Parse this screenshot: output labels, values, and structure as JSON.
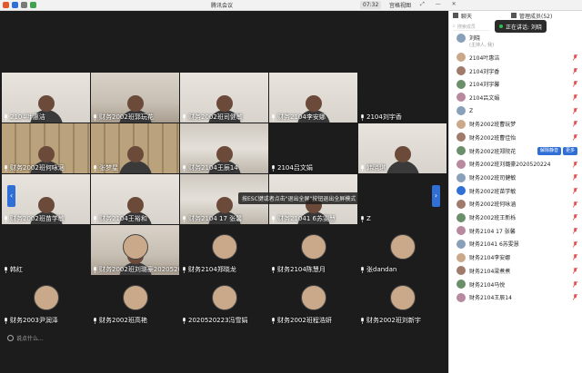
{
  "window": {
    "title": "腾讯会议",
    "time": "07:32",
    "layout_label": "宫格视图",
    "chat_tab": "聊天",
    "manage_tab": "管理成员(52)"
  },
  "toast": "按ESC键或者点击\"退出全屏\"按钮退出全屏模式",
  "chat_input": "说点什么...",
  "speaking": "正在讲话: 刘晓",
  "search_placeholder": "搜索成员",
  "tiles": [
    {
      "name": "2104叶惠洁",
      "style": "wall"
    },
    {
      "name": "财务2002班郭玩花",
      "style": "room"
    },
    {
      "name": "财务2002班司健敏",
      "style": "wall"
    },
    {
      "name": "财务2104李安娜",
      "style": "wall"
    },
    {
      "name": "2104刘宇香",
      "style": "dark"
    },
    {
      "name": "财务2002班何咏涵",
      "style": "shelf"
    },
    {
      "name": "张梦星",
      "style": "shelf"
    },
    {
      "name": "财务2104王辰14",
      "style": "office"
    },
    {
      "name": "2104吕文娟",
      "style": "dark"
    },
    {
      "name": "韩晓琪",
      "style": "wall"
    },
    {
      "name": "财务2002班苗学敏",
      "style": "wall"
    },
    {
      "name": "财务2104王裕和",
      "style": "wall"
    },
    {
      "name": "财务2104 17 张馨",
      "style": "office"
    },
    {
      "name": "财务21041 6苏雯慧",
      "style": "wall"
    },
    {
      "name": "Z",
      "style": "dark"
    },
    {
      "name": "韩红",
      "style": "dark"
    },
    {
      "name": "财务2002班刘璐豪2020520224",
      "style": "room"
    },
    {
      "name": "财务2104郑晓龙",
      "style": "dark"
    },
    {
      "name": "财务2104陈慧月",
      "style": "dark"
    },
    {
      "name": "张dandan",
      "style": "dark"
    },
    {
      "name": "财务2003尹润泽",
      "style": "dark"
    },
    {
      "name": "财务2002班高艳",
      "style": "dark"
    },
    {
      "name": "2020520223冯雪娟",
      "style": "dark"
    },
    {
      "name": "财务2002班程浩妍",
      "style": "dark"
    },
    {
      "name": "财务2002班刘新宇",
      "style": "dark"
    }
  ],
  "roster": [
    {
      "name": "刘晓",
      "sub": "(主持人, 我)"
    },
    {
      "name": "2104叶惠洁"
    },
    {
      "name": "2104刘宇香"
    },
    {
      "name": "2104刘宇馨"
    },
    {
      "name": "2104吕文娟"
    },
    {
      "name": "Z"
    },
    {
      "name": "财务2002班曹玩梦"
    },
    {
      "name": "财务2002班曹佳怡"
    },
    {
      "name": "财务2002班郑院花",
      "buttons": [
        "解除静音",
        "更多"
      ]
    },
    {
      "name": "财务2002班刘璐豪2020520224"
    },
    {
      "name": "财务2002班司健敏"
    },
    {
      "name": "财务2002班苗学敏"
    },
    {
      "name": "财务2002班何咏涵"
    },
    {
      "name": "财务2002班王新栎"
    },
    {
      "name": "财务2104 17 张馨"
    },
    {
      "name": "财务21041 6苏雯慧"
    },
    {
      "name": "财务2104李安娜"
    },
    {
      "name": "财务2104梁煮煮"
    },
    {
      "name": "财务2104马悦"
    },
    {
      "name": "财务2104王辰14"
    }
  ]
}
